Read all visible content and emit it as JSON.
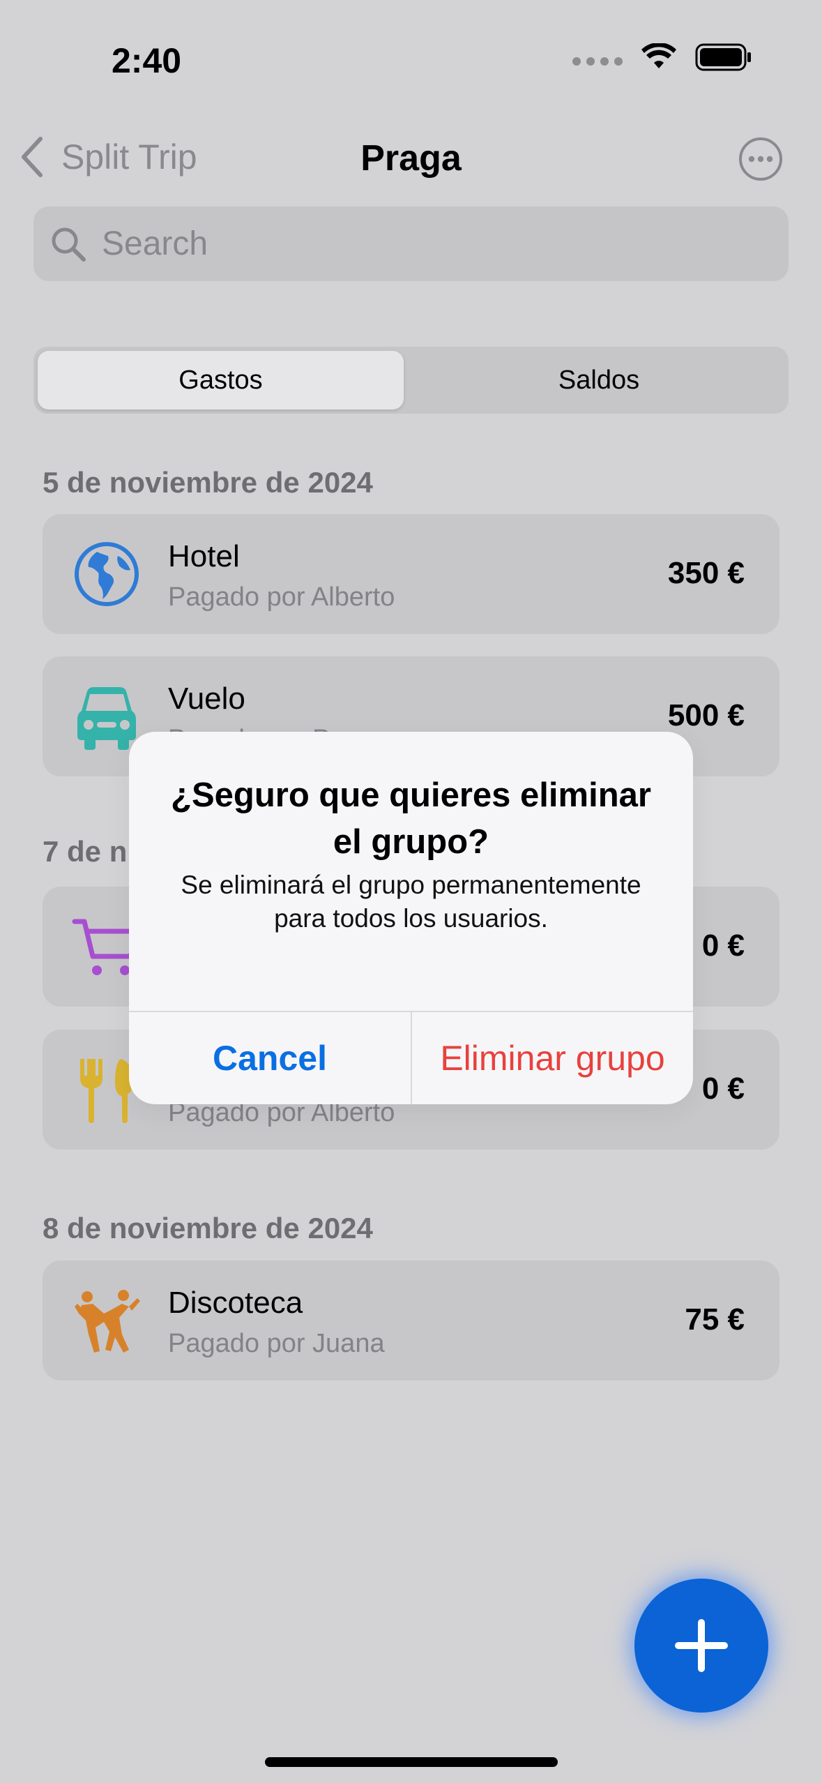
{
  "status": {
    "time": "2:40"
  },
  "nav": {
    "back_label": "Split Trip",
    "title": "Praga"
  },
  "search": {
    "placeholder": "Search"
  },
  "tabs": [
    {
      "label": "Gastos",
      "selected": true
    },
    {
      "label": "Saldos",
      "selected": false
    }
  ],
  "sections": [
    {
      "date": "5 de noviembre de 2024",
      "items": [
        {
          "title": "Hotel",
          "payer": "Pagado por Alberto",
          "amount": "350 €",
          "icon": "globe-icon"
        },
        {
          "title": "Vuelo",
          "payer": "Pagado por P",
          "amount": "500 €",
          "icon": "car-icon"
        }
      ]
    },
    {
      "date": "7 de n",
      "items": [
        {
          "title": "",
          "payer": "",
          "amount": "0 €",
          "icon": "cart-icon"
        },
        {
          "title": "",
          "payer": "Pagado por Alberto",
          "amount": "0 €",
          "icon": "fork-knife-icon"
        }
      ]
    },
    {
      "date": "8 de noviembre de 2024",
      "items": [
        {
          "title": "Discoteca",
          "payer": "Pagado por Juana",
          "amount": "75 €",
          "icon": "dancing-icon"
        }
      ]
    }
  ],
  "alert": {
    "title": "¿Seguro que quieres eliminar el grupo?",
    "message": "Se eliminará el grupo permanentemente para todos los usuarios.",
    "cancel_label": "Cancel",
    "delete_label": "Eliminar grupo"
  },
  "colors": {
    "accent": "#0b63d5",
    "destructive": "#e8413d",
    "link": "#0a6fe3"
  }
}
